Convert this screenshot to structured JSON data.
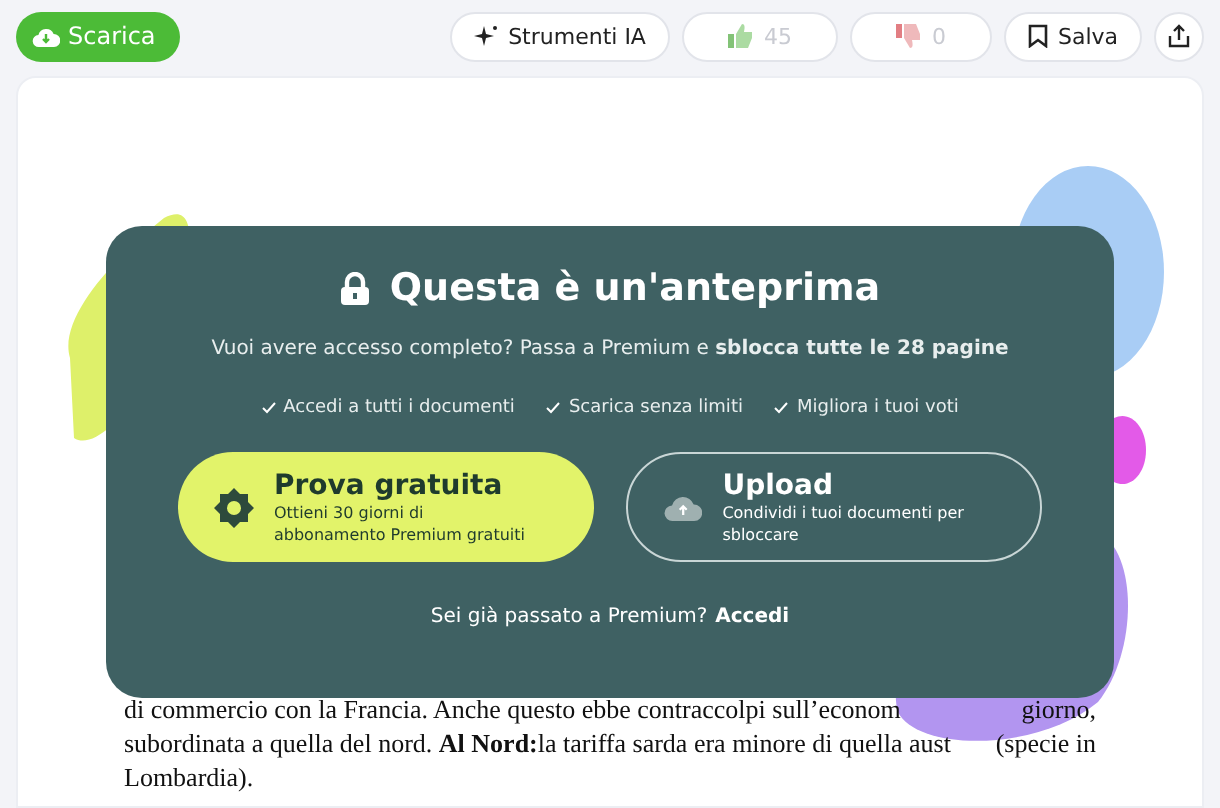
{
  "toolbar": {
    "download": {
      "label": "Scarica"
    },
    "ai_tools": {
      "label": "Strumenti IA"
    },
    "votes": [
      {
        "kind": "up",
        "count": "45",
        "disabled": true
      },
      {
        "kind": "down",
        "count": "0",
        "disabled": true
      }
    ],
    "save": {
      "label": "Salva"
    }
  },
  "preview": {
    "title": "Questa è un'anteprima",
    "subtitle": "Vuoi avere accesso completo? Passa a Premium e **sblocca tutte le 28 pagine**",
    "benefits": [
      "Accedi a tutti i documenti",
      "Scarica senza limiti",
      "Migliora i tuoi voti"
    ],
    "options": [
      {
        "kind": "trial",
        "title": "Prova gratuita",
        "text": "Ottieni 30 giorni di abbonamento Premium gratuiti"
      },
      {
        "kind": "upload",
        "title": "Upload",
        "text": "Condividi i tuoi documenti per sbloccare"
      }
    ],
    "login_prompt": "Sei già passato a Premium?",
    "login_link": "Accedi"
  },
  "document": {
    "lines": [
      [
        "di commercio con la Francia. Anche questo ebbe contraccolpi sull’econom",
        "giorno,"
      ],
      [
        "subordinata a quella del nord. **Al Nord:**la tariffa sarda era minore di quella aust",
        "(specie in"
      ],
      [
        "Lombardia)."
      ]
    ]
  }
}
